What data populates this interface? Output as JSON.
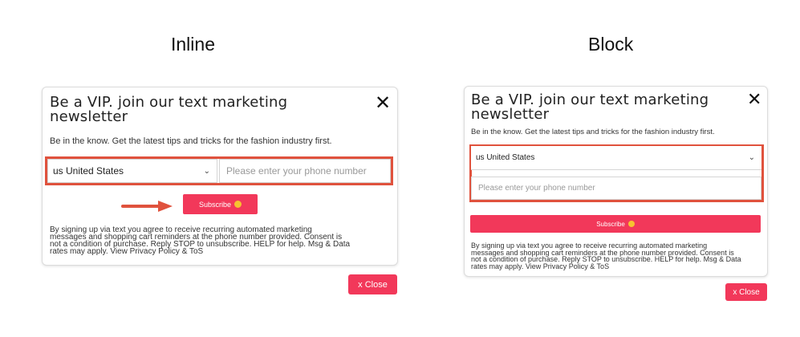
{
  "labels": {
    "inline": "Inline",
    "block": "Block"
  },
  "popup": {
    "title_line1": "Be a VIP. join our text marketing",
    "title_line2": "newsletter",
    "close_glyph": "✕",
    "description": "Be in the know. Get the latest tips and tricks for the fashion industry first.",
    "country_value": "us United States",
    "phone_placeholder": "Please enter your phone number",
    "subscribe_label": "Subscribe",
    "legal_line1": "By signing up via text you agree to receive recurring automated marketing",
    "legal_line2": "messages and shopping cart reminders at the phone number provided. Consent is",
    "legal_line3": "not a condition of purchase. Reply STOP to unsubscribe. HELP for help. Msg & Data",
    "legal_line4": "rates may apply. View Privacy Policy & ToS",
    "close_button_label": "x Close"
  },
  "colors": {
    "accent": "#f2385a",
    "highlight": "#e0523d"
  },
  "icons": {
    "close": "close-icon",
    "chevron": "chevron-down-icon",
    "emoji": "smiley-icon",
    "arrow": "arrow-right-icon"
  }
}
